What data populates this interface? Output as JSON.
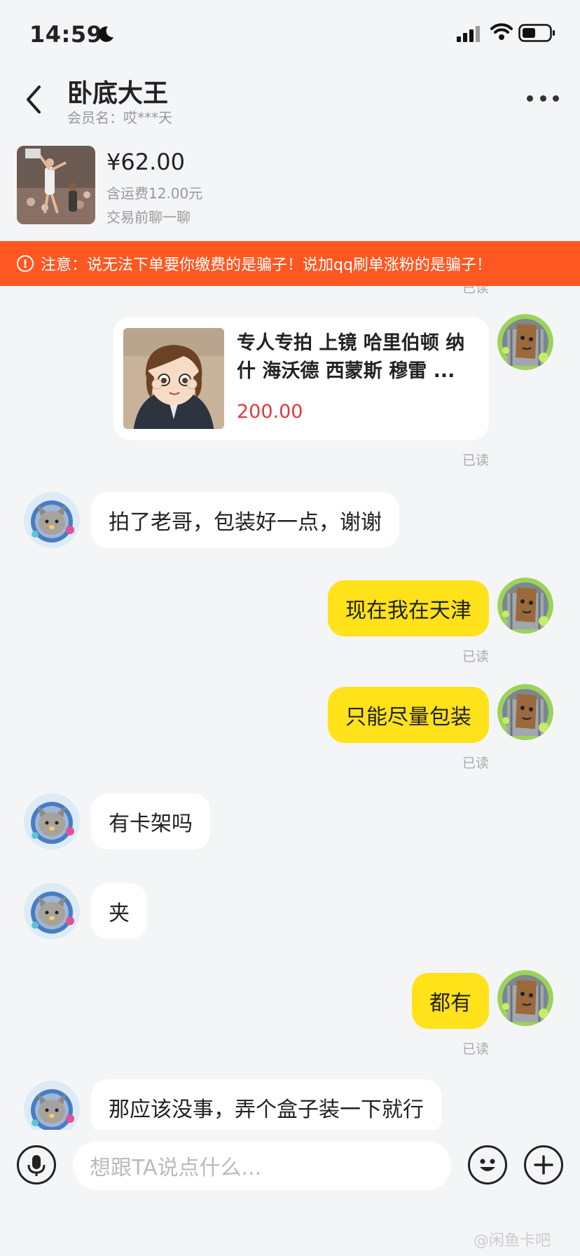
{
  "status": {
    "time": "14:59"
  },
  "header": {
    "title": "卧底大王",
    "member": "会员名：哎***天"
  },
  "product": {
    "price": "¥62.00",
    "shipping": "含运费12.00元",
    "chat_hint": "交易前聊一聊"
  },
  "warning": {
    "icon": "!",
    "text": "注意：说无法下单要你缴费的是骗子！说加qq刷单涨粉的是骗子！"
  },
  "messages": {
    "top_read": "已读",
    "card": {
      "desc": "专人专拍 上镜 哈里伯顿 纳什 海沃德 西蒙斯 穆雷 ...",
      "price": "200.00",
      "read": "已读"
    },
    "m1": "拍了老哥，包装好一点，谢谢",
    "m2": "现在我在天津",
    "m2_read": "已读",
    "m3": "只能尽量包装",
    "m3_read": "已读",
    "m4": "有卡架吗",
    "m5": "夹",
    "m6": "都有",
    "m6_read": "已读",
    "m7": "那应该没事，弄个盒子装一下就行"
  },
  "input": {
    "placeholder": "想跟TA说点什么..."
  },
  "watermark": "@闲鱼卡吧",
  "colors": {
    "accent_yellow": "#ffe21a",
    "warning_orange": "#ff5722",
    "price_red": "#e0393e"
  },
  "icons": [
    "moon-icon",
    "signal-icon",
    "wifi-icon",
    "battery-icon",
    "back-icon",
    "more-icon",
    "microphone-icon",
    "emoji-icon",
    "plus-icon",
    "warning-icon"
  ]
}
